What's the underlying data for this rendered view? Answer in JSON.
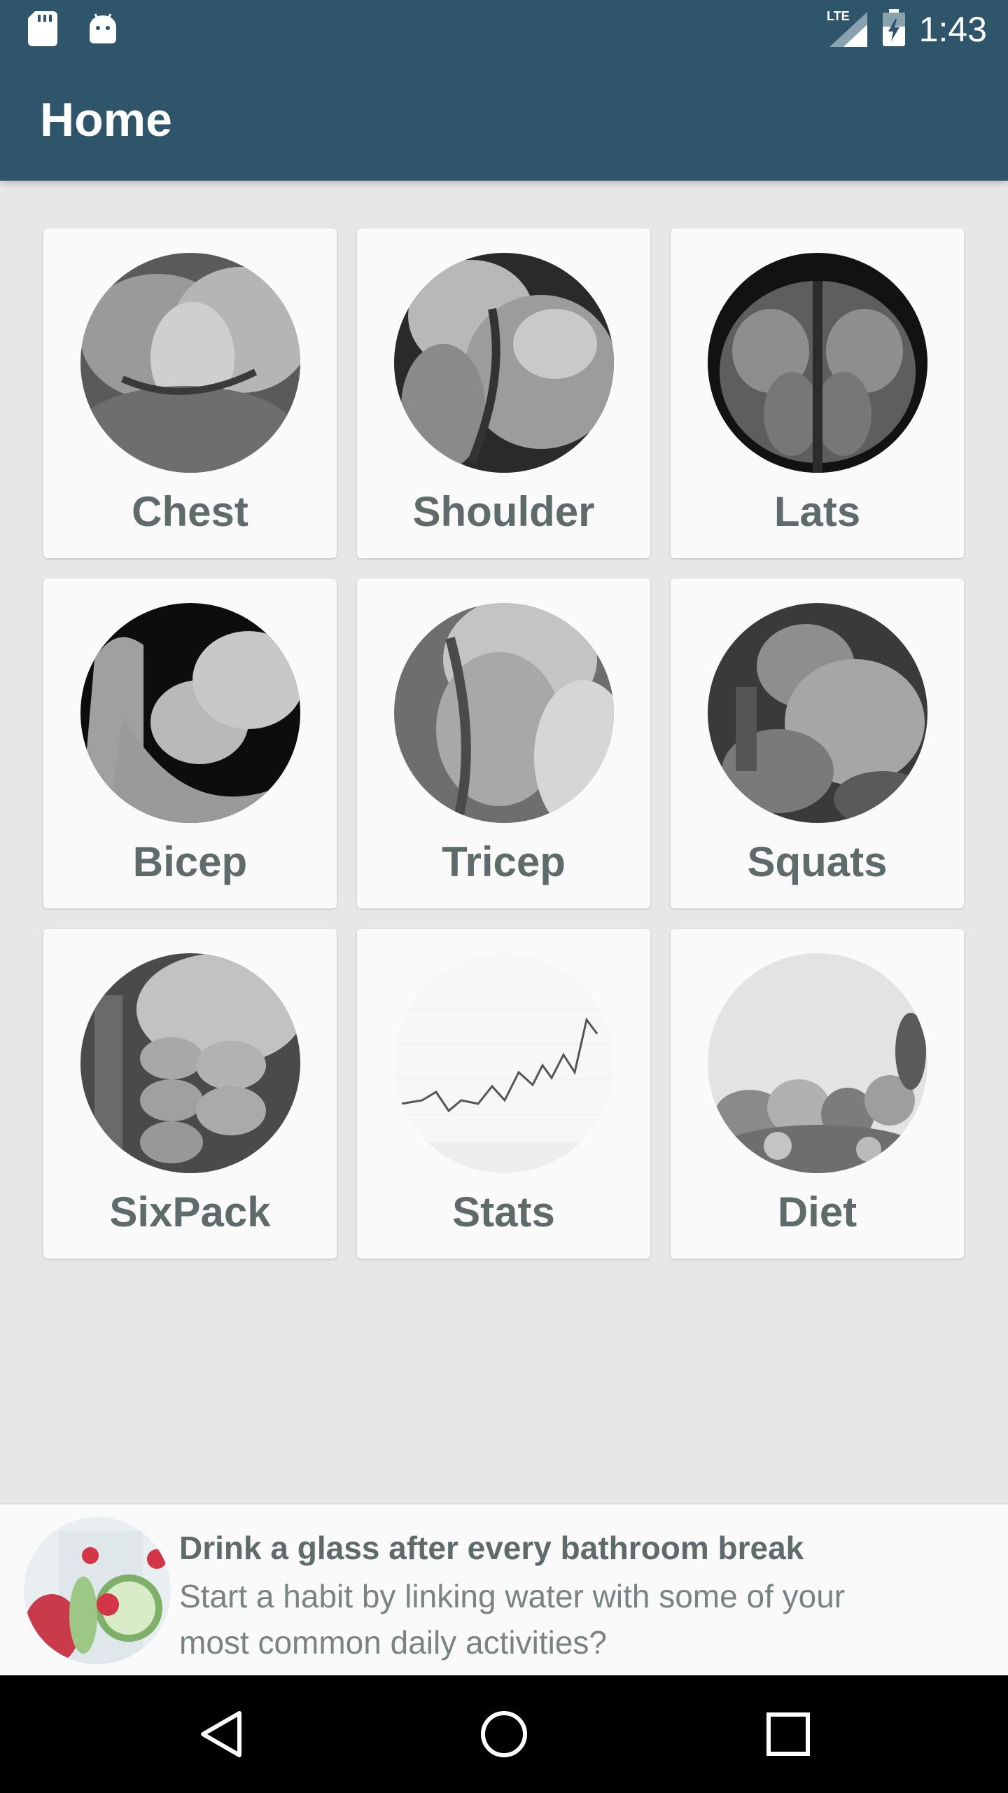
{
  "status_bar": {
    "time": "1:43",
    "network": "LTE",
    "icons": [
      "sd-card-icon",
      "android-icon",
      "lte-signal-icon",
      "battery-charging-icon"
    ]
  },
  "app_bar": {
    "title": "Home"
  },
  "tiles": [
    {
      "label": "Chest",
      "icon": "chest-image"
    },
    {
      "label": "Shoulder",
      "icon": "shoulder-image"
    },
    {
      "label": "Lats",
      "icon": "lats-image"
    },
    {
      "label": "Bicep",
      "icon": "bicep-image"
    },
    {
      "label": "Tricep",
      "icon": "tricep-image"
    },
    {
      "label": "Squats",
      "icon": "squats-image"
    },
    {
      "label": "SixPack",
      "icon": "sixpack-image"
    },
    {
      "label": "Stats",
      "icon": "stats-chart-image"
    },
    {
      "label": "Diet",
      "icon": "diet-image"
    }
  ],
  "tip": {
    "title": "Drink a glass after every bathroom break",
    "body": "Start a habit by linking water with some of your most common daily activities?"
  },
  "nav_bar": {
    "icons": [
      "back-icon",
      "home-icon",
      "recents-icon"
    ]
  },
  "colors": {
    "primary": "#2e5569",
    "background": "#e8e7e8",
    "tile_background": "#fafafa",
    "label_text": "#5f6b6b"
  }
}
